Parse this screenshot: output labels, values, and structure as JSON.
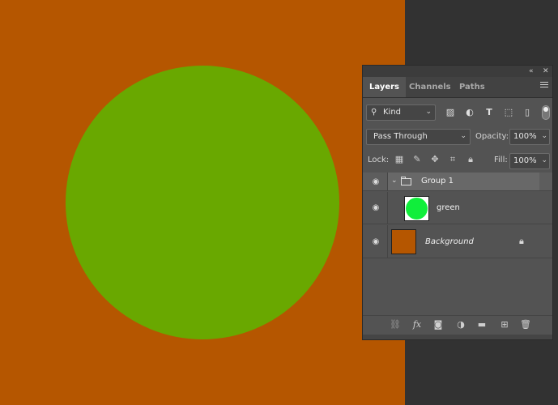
{
  "canvas": {
    "background_color": "#b55600",
    "circle_color": "#69a800"
  },
  "panel": {
    "tabs": [
      {
        "label": "Layers",
        "active": true
      },
      {
        "label": "Channels",
        "active": false
      },
      {
        "label": "Paths",
        "active": false
      }
    ],
    "titlebar": {
      "collapse_icon": "double-chevron-icon",
      "close_icon": "close-icon",
      "collapse_glyph": "«",
      "close_glyph": "✕"
    },
    "filter": {
      "kind_label": "Kind"
    },
    "blend": {
      "mode": "Pass Through",
      "opacity_label": "Opacity:",
      "opacity_value": "100%"
    },
    "lock": {
      "label": "Lock:",
      "fill_label": "Fill:",
      "fill_value": "100%"
    },
    "layers": [
      {
        "name": "Group 1",
        "type": "group",
        "visible": true
      },
      {
        "name": "green",
        "type": "shape",
        "visible": true,
        "thumb_color": "#10ee3b"
      },
      {
        "name": "Background",
        "type": "background",
        "visible": true,
        "locked": true,
        "thumb_color": "#b55600"
      }
    ]
  }
}
